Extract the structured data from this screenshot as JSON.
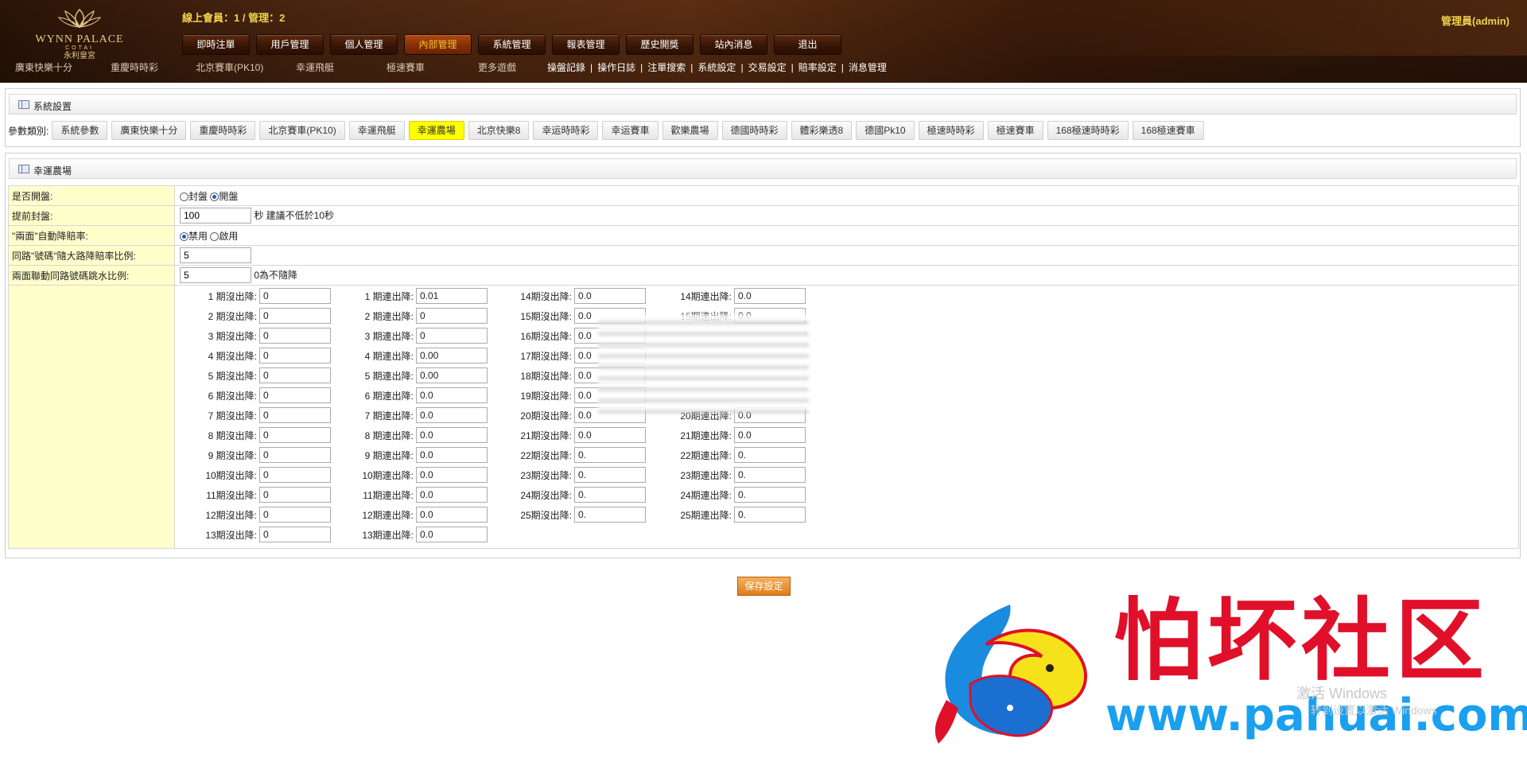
{
  "header": {
    "logo": {
      "line1": "WYNN PALACE",
      "line2": "COTAI",
      "line3": "永利皇宮"
    },
    "online_text": "線上會員：1 / 管理：2",
    "admin_text": "管理員(admin)",
    "main_nav": [
      "即時注單",
      "用戶管理",
      "個人管理",
      "內部管理",
      "系統管理",
      "報表管理",
      "歷史開獎",
      "站內消息",
      "退出"
    ],
    "active_nav": "內部管理",
    "game_links": [
      "廣東快樂十分",
      "重慶時時彩",
      "北京賽車(PK10)",
      "幸運飛艇",
      "極速賽車",
      "更多遊戲"
    ],
    "admin_links": [
      "操盤記錄",
      "操作日誌",
      "注單搜索",
      "系統設定",
      "交易設定",
      "賠率設定",
      "消息管理"
    ]
  },
  "system_panel": {
    "title": "系統設置",
    "param_label": "參數類別:",
    "params": [
      "系統參數",
      "廣東快樂十分",
      "重慶時時彩",
      "北京賽車(PK10)",
      "幸運飛艇",
      "幸運農場",
      "北京快樂8",
      "幸运時時彩",
      "幸运賽車",
      "歡樂農場",
      "德國時時彩",
      "體彩樂透8",
      "德國Pk10",
      "極速時時彩",
      "極速賽車",
      "168極速時時彩",
      "168極速賽車"
    ],
    "active_param": "幸運農場"
  },
  "farm_panel": {
    "title": "幸運農場",
    "rows": {
      "open_label": "是否開盤:",
      "open_opt1": "封盤",
      "open_opt2": "開盤",
      "early_label": "提前封盤:",
      "early_value": "100",
      "early_hint": "秒 建議不低於10秒",
      "auto_label": "\"兩面\"自動降賠率:",
      "auto_opt1": "禁用",
      "auto_opt2": "啟用",
      "ratio_label": "同路\"號碼\"隨大路降賠率比例:",
      "ratio_value": "5",
      "linked_label": "兩面聯動同路號碼跳水比例:",
      "linked_value": "5",
      "linked_hint": "0為不隨降"
    },
    "col1": [
      {
        "k": "1 期沒出降:",
        "v": "0"
      },
      {
        "k": "2 期沒出降:",
        "v": "0"
      },
      {
        "k": "3 期沒出降:",
        "v": "0"
      },
      {
        "k": "4 期沒出降:",
        "v": "0"
      },
      {
        "k": "5 期沒出降:",
        "v": "0"
      },
      {
        "k": "6 期沒出降:",
        "v": "0"
      },
      {
        "k": "7 期沒出降:",
        "v": "0"
      },
      {
        "k": "8 期沒出降:",
        "v": "0"
      },
      {
        "k": "9 期沒出降:",
        "v": "0"
      },
      {
        "k": "10期沒出降:",
        "v": "0"
      },
      {
        "k": "11期沒出降:",
        "v": "0"
      },
      {
        "k": "12期沒出降:",
        "v": "0"
      },
      {
        "k": "13期沒出降:",
        "v": "0"
      }
    ],
    "col2": [
      {
        "k": "1 期連出降:",
        "v": "0.01"
      },
      {
        "k": "2 期連出降:",
        "v": "0"
      },
      {
        "k": "3 期連出降:",
        "v": "0"
      },
      {
        "k": "4 期連出降:",
        "v": "0.00"
      },
      {
        "k": "5 期連出降:",
        "v": "0.00"
      },
      {
        "k": "6 期連出降:",
        "v": "0.0"
      },
      {
        "k": "7 期連出降:",
        "v": "0.0"
      },
      {
        "k": "8 期連出降:",
        "v": "0.0"
      },
      {
        "k": "9 期連出降:",
        "v": "0.0"
      },
      {
        "k": "10期連出降:",
        "v": "0.0"
      },
      {
        "k": "11期連出降:",
        "v": "0.0"
      },
      {
        "k": "12期連出降:",
        "v": "0.0"
      },
      {
        "k": "13期連出降:",
        "v": "0.0"
      }
    ],
    "col3": [
      {
        "k": "14期沒出降:",
        "v": "0.0"
      },
      {
        "k": "15期沒出降:",
        "v": "0.0"
      },
      {
        "k": "16期沒出降:",
        "v": "0.0"
      },
      {
        "k": "17期沒出降:",
        "v": "0.0"
      },
      {
        "k": "18期沒出降:",
        "v": "0.0"
      },
      {
        "k": "19期沒出降:",
        "v": "0.0"
      },
      {
        "k": "20期沒出降:",
        "v": "0.0"
      },
      {
        "k": "21期沒出降:",
        "v": "0.0"
      },
      {
        "k": "22期沒出降:",
        "v": "0."
      },
      {
        "k": "23期沒出降:",
        "v": "0."
      },
      {
        "k": "24期沒出降:",
        "v": "0."
      },
      {
        "k": "25期沒出降:",
        "v": "0."
      }
    ],
    "col4": [
      {
        "k": "14期連出降:",
        "v": "0.0"
      },
      {
        "k": "15期連出降:",
        "v": "0.0"
      },
      {
        "k": "",
        "v": ""
      },
      {
        "k": "",
        "v": ""
      },
      {
        "k": "",
        "v": ""
      },
      {
        "k": "",
        "v": ""
      },
      {
        "k": "20期連出降:",
        "v": "0.0"
      },
      {
        "k": "21期連出降:",
        "v": "0.0"
      },
      {
        "k": "22期連出降:",
        "v": "0."
      },
      {
        "k": "23期連出降:",
        "v": "0."
      },
      {
        "k": "24期連出降:",
        "v": "0."
      },
      {
        "k": "25期連出降:",
        "v": "0."
      }
    ]
  },
  "save_label": "保存設定",
  "watermark": {
    "text": "怕坏社区",
    "url": "www.pahuai.com",
    "win1": "激活 Windows",
    "win2": "转到设置以激活 Windows"
  }
}
